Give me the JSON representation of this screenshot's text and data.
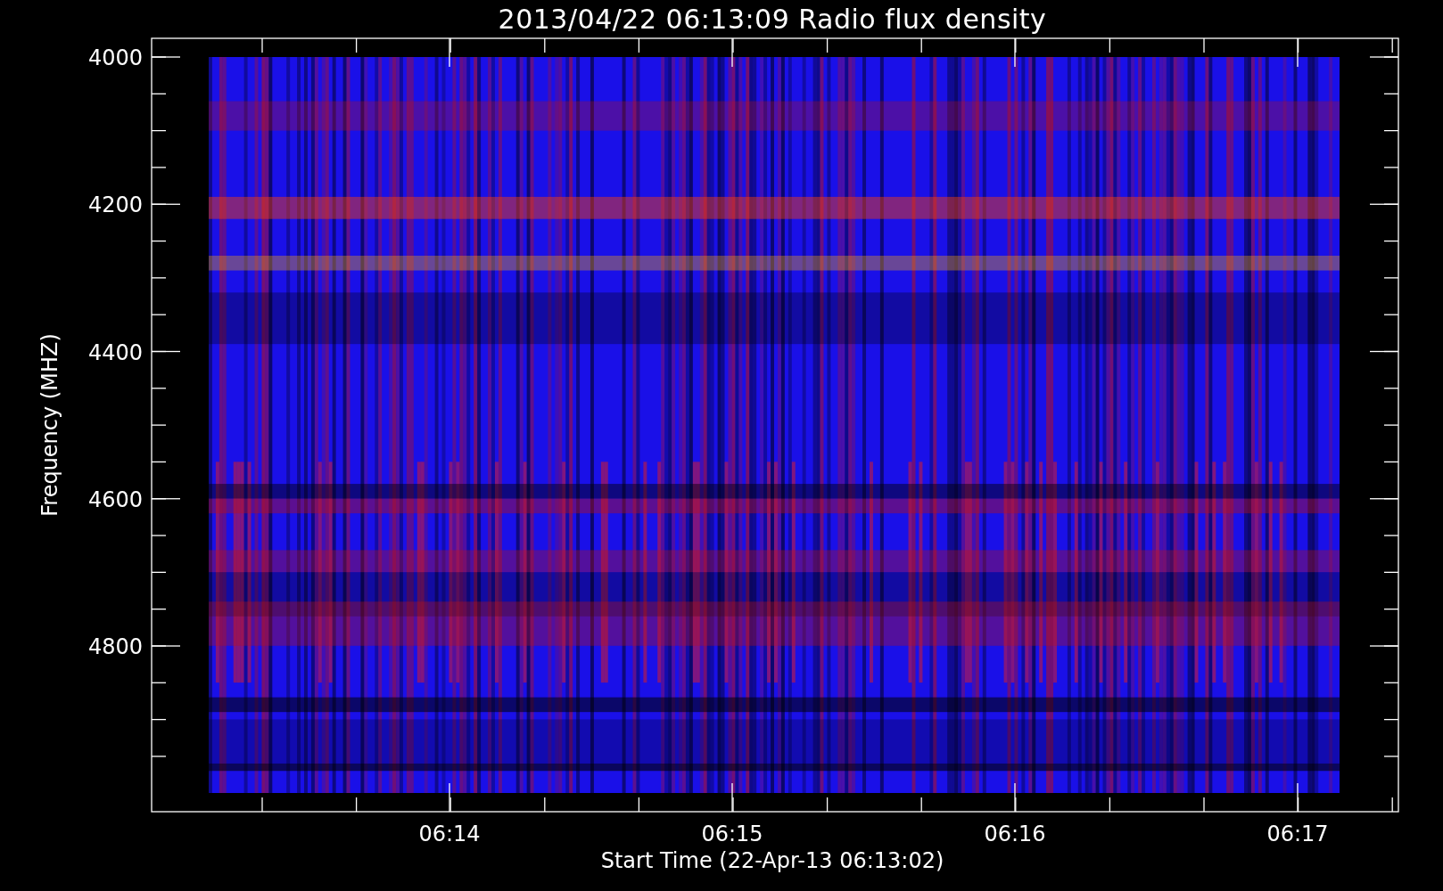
{
  "title": "2013/04/22 06:13:09 Radio flux density",
  "y_axis": {
    "label": "Frequency (MHZ)",
    "ticks": [
      "4000",
      "4200",
      "4400",
      "4600",
      "4800"
    ]
  },
  "x_axis": {
    "label": "Start Time (22-Apr-13 06:13:02)",
    "ticks": [
      "06:14",
      "06:15",
      "06:16",
      "06:17"
    ]
  }
}
